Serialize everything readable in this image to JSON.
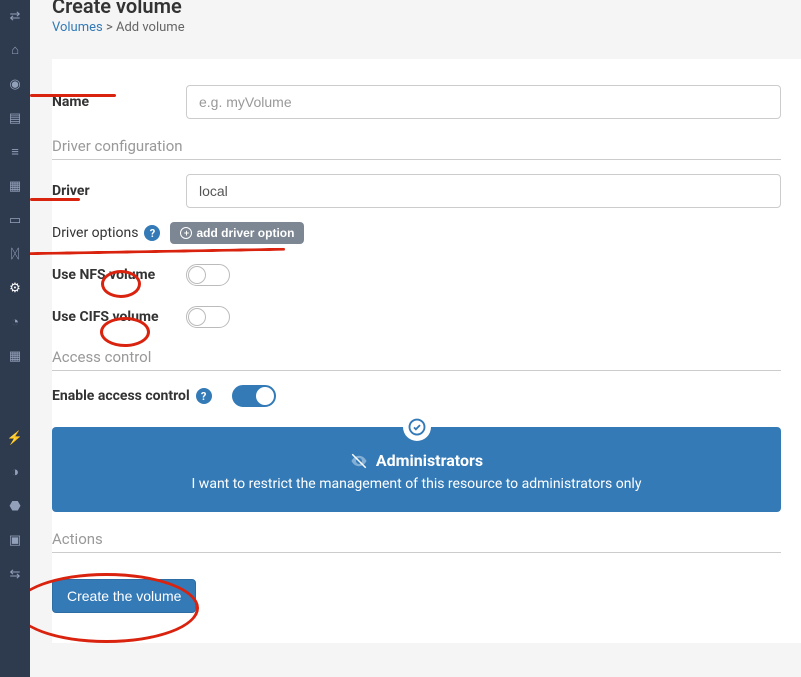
{
  "page": {
    "title": "Create volume",
    "breadcrumb_link": "Volumes",
    "breadcrumb_sep": " > ",
    "breadcrumb_current": "Add volume"
  },
  "form": {
    "name_label": "Name",
    "name_placeholder": "e.g. myVolume",
    "driver_section": "Driver configuration",
    "driver_label": "Driver",
    "driver_value": "local",
    "driver_options_label": "Driver options",
    "add_option_label": "add driver option",
    "nfs_label": "Use NFS volume",
    "cifs_label": "Use CIFS volume",
    "access_section": "Access control",
    "access_toggle_label": "Enable access control",
    "access_box_title": "Administrators",
    "access_box_desc": "I want to restrict the management of this resource to administrators only",
    "actions_section": "Actions",
    "create_btn": "Create the volume"
  }
}
